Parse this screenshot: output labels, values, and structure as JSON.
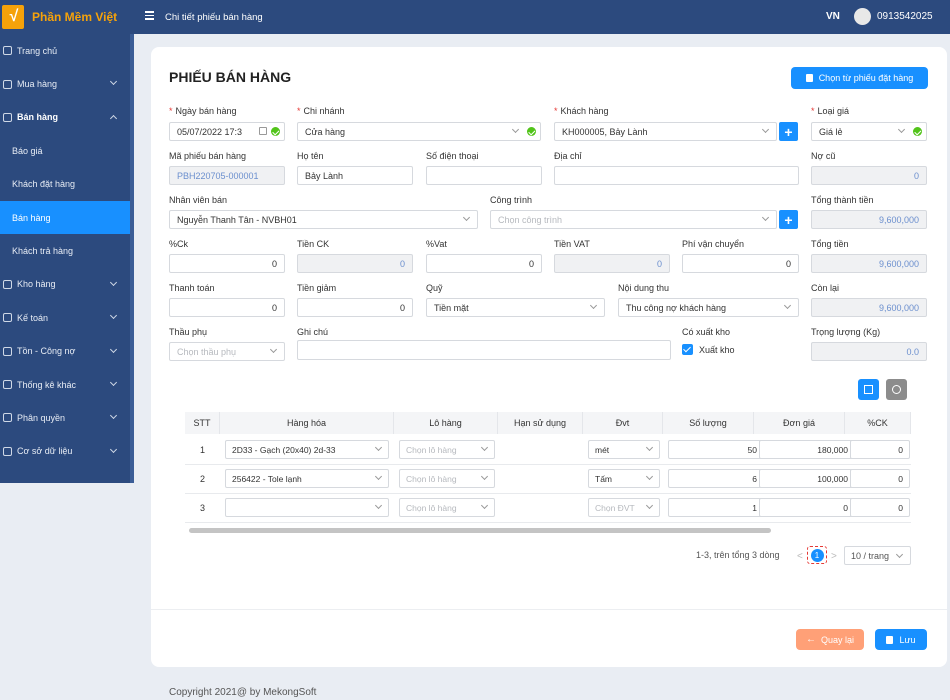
{
  "brand": {
    "name": "Phần Mềm Việt",
    "logo_glyph": "√"
  },
  "header": {
    "breadcrumb": "Chi tiết phiếu bán hàng",
    "language": "VN",
    "phone": "0913542025"
  },
  "sidebar": {
    "items": [
      {
        "label": "Trang chủ",
        "icon": "home-icon"
      },
      {
        "label": "Mua hàng",
        "icon": "cart-icon"
      },
      {
        "label": "Bán hàng",
        "icon": "sale-icon"
      },
      {
        "label": "Báo giá"
      },
      {
        "label": "Khách đặt hàng"
      },
      {
        "label": "Bán hàng"
      },
      {
        "label": "Khách trả hàng"
      },
      {
        "label": "Kho hàng",
        "icon": "warehouse-icon"
      },
      {
        "label": "Kế toán",
        "icon": "accounting-icon"
      },
      {
        "label": "Tồn - Công nợ",
        "icon": "debt-icon"
      },
      {
        "label": "Thống kê khác",
        "icon": "stats-icon"
      },
      {
        "label": "Phân quyền",
        "icon": "permission-icon"
      },
      {
        "label": "Cơ sở dữ liệu",
        "icon": "database-icon"
      }
    ]
  },
  "form": {
    "title": "PHIẾU BÁN HÀNG",
    "choose_order_button": "Chọn từ phiếu đặt hàng",
    "ngay_ban_hang": {
      "label": "Ngày bán hàng",
      "value": "05/07/2022 17:3"
    },
    "chi_nhanh": {
      "label": "Chi nhánh",
      "value": "Cửa hàng"
    },
    "khach_hang": {
      "label": "Khách hàng",
      "value": "KH000005, Bảy Lành"
    },
    "loai_gia": {
      "label": "Loại giá",
      "value": "Giá lẻ"
    },
    "ma_phieu": {
      "label": "Mã phiếu bán hàng",
      "value": "PBH220705-000001"
    },
    "ho_ten": {
      "label": "Họ tên",
      "value": "Bảy Lành"
    },
    "so_dien_thoai": {
      "label": "Số điện thoại",
      "value": ""
    },
    "dia_chi": {
      "label": "Địa chỉ",
      "value": ""
    },
    "no_cu": {
      "label": "Nợ cũ",
      "value": "0"
    },
    "nhan_vien": {
      "label": "Nhân viên bán",
      "value": "Nguyễn Thanh Tân - NVBH01"
    },
    "cong_trinh": {
      "label": "Công trình",
      "placeholder": "Chọn công trình"
    },
    "tong_thanh_tien": {
      "label": "Tổng thành tiền",
      "value": "9,600,000"
    },
    "ck": {
      "label": "%Ck",
      "value": "0"
    },
    "tien_ck": {
      "label": "Tiền CK",
      "value": "0"
    },
    "vat": {
      "label": "%Vat",
      "value": "0"
    },
    "tien_vat": {
      "label": "Tiền VAT",
      "value": "0"
    },
    "phi_van_chuyen": {
      "label": "Phí vận chuyển",
      "value": "0"
    },
    "tong_tien": {
      "label": "Tổng tiền",
      "value": "9,600,000"
    },
    "thanh_toan": {
      "label": "Thanh toán",
      "value": "0"
    },
    "tien_giam": {
      "label": "Tiền giảm",
      "value": "0"
    },
    "quy": {
      "label": "Quỹ",
      "value": "Tiền mặt"
    },
    "noi_dung_thu": {
      "label": "Nội dung thu",
      "value": "Thu công nợ khách hàng"
    },
    "con_lai": {
      "label": "Còn lại",
      "value": "9,600,000"
    },
    "thau_phu": {
      "label": "Thầu phụ",
      "placeholder": "Chọn thầu phụ"
    },
    "ghi_chu": {
      "label": "Ghi chú",
      "value": ""
    },
    "co_xuat_kho": {
      "label": "Có xuất kho",
      "checkbox_label": "Xuất kho",
      "checked": true
    },
    "trong_luong": {
      "label": "Trọng lượng (Kg)",
      "value": "0.0"
    }
  },
  "table": {
    "columns": [
      "STT",
      "Hàng hóa",
      "Lô hàng",
      "Hạn sử dụng",
      "Đvt",
      "Số lượng",
      "Đơn giá",
      "%CK"
    ],
    "rows": [
      {
        "stt": "1",
        "hang_hoa": "2D33 - Gạch (20x40) 2d-33",
        "lo_hang": "Chọn lô hàng",
        "han_su_dung": "",
        "dvt": "mét",
        "so_luong": "50",
        "don_gia": "180,000",
        "ck": "0"
      },
      {
        "stt": "2",
        "hang_hoa": "256422 - Tole lạnh",
        "lo_hang": "Chọn lô hàng",
        "han_su_dung": "",
        "dvt": "Tấm",
        "so_luong": "6",
        "don_gia": "100,000",
        "ck": "0"
      },
      {
        "stt": "3",
        "hang_hoa": "",
        "lo_hang": "Chọn lô hàng",
        "han_su_dung": "",
        "dvt": "Chọn ĐVT",
        "so_luong": "1",
        "don_gia": "0",
        "ck": "0"
      }
    ],
    "add_button_color": "#1890ff",
    "settings_button_color": "#8c8c8c"
  },
  "pagination": {
    "summary": "1-3, trên tổng 3 dòng",
    "prev": "<",
    "current": "1",
    "next": ">",
    "page_size": "10 / trang"
  },
  "footer_buttons": {
    "back": "Quay lại",
    "save": "Lưu"
  },
  "copyright": "Copyright 2021@ by MekongSoft",
  "colors": {
    "sidebar": "#2c4a7e",
    "accent": "#1890ff",
    "brand": "#f5a20a",
    "back_button": "#ffa077",
    "ok": "#52c41a"
  }
}
